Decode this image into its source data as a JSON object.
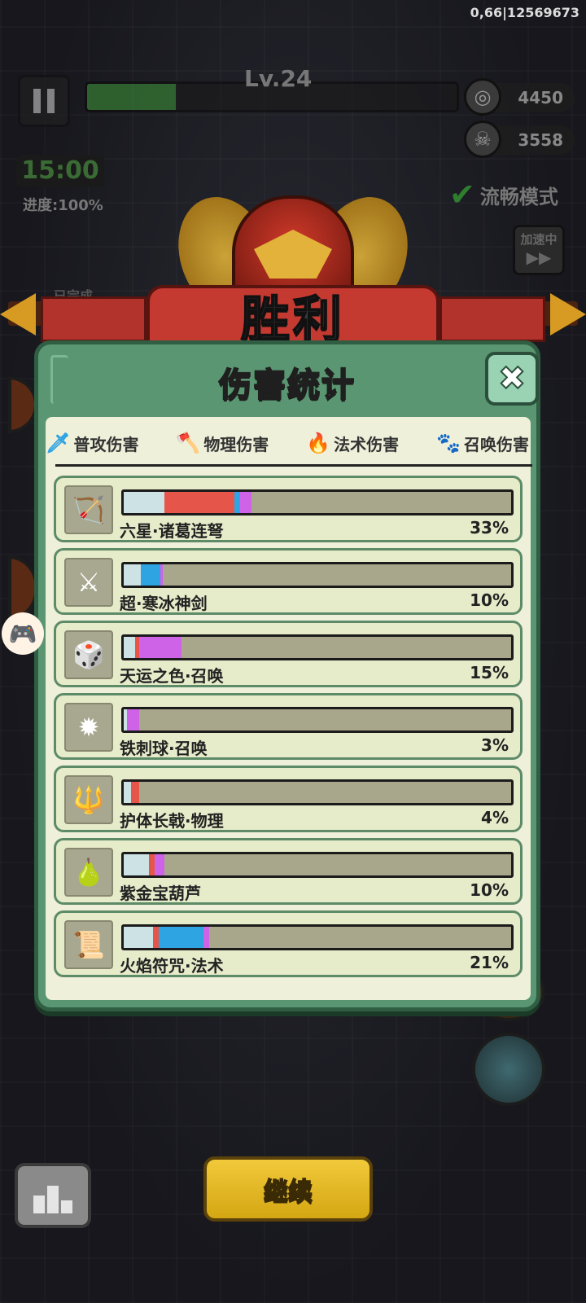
{
  "debug_text": "0,66|12569673",
  "hud": {
    "level": "Lv.24",
    "xp_progress": 0.24,
    "coins": "4450",
    "kills": "3558",
    "timer": "15:00",
    "progress_text": "进度:100%",
    "smooth_mode": "流畅模式",
    "speed_label": "加速中",
    "speed_arrows": "▶▶",
    "completed_tag": "已完成"
  },
  "victory_text": "胜利",
  "modal": {
    "title": "伤害统计",
    "close_icon": "✖",
    "legend": [
      {
        "label": "普攻伤害",
        "icon": "sword-icon",
        "glyph": "🗡",
        "color": "#2fa4e3"
      },
      {
        "label": "物理伤害",
        "icon": "axe-icon",
        "glyph": "🪓",
        "color": "#e6554a"
      },
      {
        "label": "法术伤害",
        "icon": "flame-icon",
        "glyph": "🔥",
        "color": "#2f7fe3"
      },
      {
        "label": "召唤伤害",
        "icon": "paw-icon",
        "glyph": "🐾",
        "color": "#b44ad8"
      }
    ],
    "rows": [
      {
        "name": "六星·诸葛连弩",
        "percent": "33%",
        "icon": "crossbow-icon",
        "glyph": "🏹",
        "segments": [
          {
            "type": "normal",
            "v": 10.5
          },
          {
            "type": "physical",
            "v": 18
          },
          {
            "type": "magic",
            "v": 1.5
          },
          {
            "type": "summon",
            "v": 3
          }
        ]
      },
      {
        "name": "超·寒冰神剑",
        "percent": "10%",
        "icon": "ice-sword-icon",
        "glyph": "⚔",
        "segments": [
          {
            "type": "normal",
            "v": 4.5
          },
          {
            "type": "magic",
            "v": 5
          },
          {
            "type": "summon",
            "v": 0.5
          }
        ]
      },
      {
        "name": "天运之色·召唤",
        "percent": "15%",
        "icon": "dice-icon",
        "glyph": "🎲",
        "segments": [
          {
            "type": "normal",
            "v": 3
          },
          {
            "type": "physical",
            "v": 1
          },
          {
            "type": "summon",
            "v": 11
          }
        ]
      },
      {
        "name": "铁刺球·召唤",
        "percent": "3%",
        "icon": "spike-ball-icon",
        "glyph": "✹",
        "segments": [
          {
            "type": "normal",
            "v": 0.8
          },
          {
            "type": "summon",
            "v": 3.2
          }
        ]
      },
      {
        "name": "护体长戟·物理",
        "percent": "4%",
        "icon": "halberd-icon",
        "glyph": "🔱",
        "segments": [
          {
            "type": "normal",
            "v": 1.8
          },
          {
            "type": "physical",
            "v": 2.2
          }
        ]
      },
      {
        "name": "紫金宝葫芦",
        "percent": "10%",
        "icon": "gourd-icon",
        "glyph": "🍐",
        "segments": [
          {
            "type": "normal",
            "v": 6.5
          },
          {
            "type": "physical",
            "v": 1.5
          },
          {
            "type": "summon",
            "v": 2.5
          }
        ]
      },
      {
        "name": "火焰符咒·法术",
        "percent": "21%",
        "icon": "fire-talisman-icon",
        "glyph": "📜",
        "segments": [
          {
            "type": "normal",
            "v": 7.5
          },
          {
            "type": "physical",
            "v": 1.5
          },
          {
            "type": "magic",
            "v": 11.5
          },
          {
            "type": "summon",
            "v": 1.5
          }
        ]
      }
    ]
  },
  "continue_label": "继续"
}
